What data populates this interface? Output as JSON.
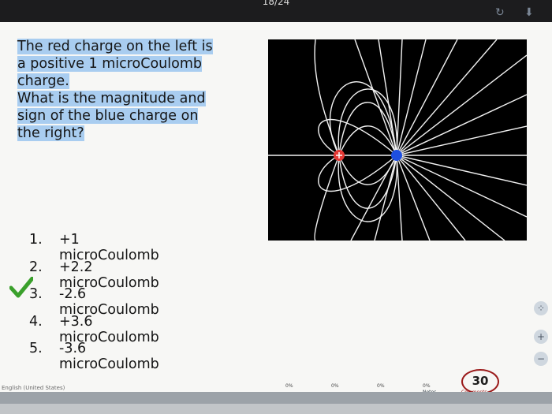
{
  "header": {
    "page_counter": "18/24"
  },
  "toolbar": {
    "refresh_icon": "refresh-icon",
    "download_icon": "download-icon"
  },
  "question": {
    "lines": [
      "The red charge on the left is",
      "a positive 1 microCoulomb",
      "charge.",
      "What is the magnitude and",
      "sign of the blue charge on",
      "the right?"
    ]
  },
  "answers": [
    {
      "num": "1.",
      "text": "+1 microCoulomb"
    },
    {
      "num": "2.",
      "text": "+2.2 microCoulomb"
    },
    {
      "num": "3.",
      "text": "-2.6 microCoulomb",
      "correct": true
    },
    {
      "num": "4.",
      "text": "+3.6 microCoulomb"
    },
    {
      "num": "5.",
      "text": "-3.6 microCoulomb"
    }
  ],
  "colors": {
    "highlight": "#a9cdf0",
    "check": "#3aa02b",
    "positive_charge": "#e53935",
    "negative_charge": "#1e4fe0",
    "badge_border": "#9b1b1b"
  },
  "footer": {
    "language": "English (United States)",
    "percents": [
      "0%",
      "0%",
      "0%",
      "0%"
    ],
    "notes_label": "Notes",
    "counter": "30",
    "comments_label": "Comments"
  }
}
